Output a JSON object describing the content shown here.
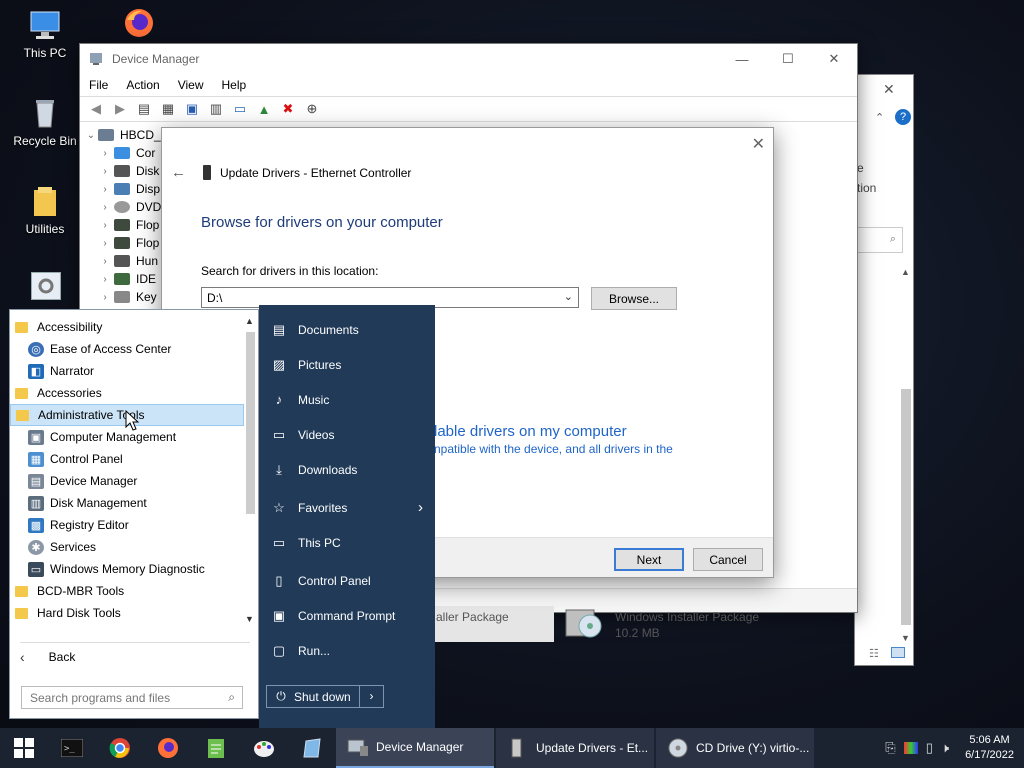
{
  "desktop": {
    "icons": [
      {
        "label": "This PC"
      },
      {
        "label": "Recycle Bin"
      },
      {
        "label": "Utilities"
      }
    ]
  },
  "device_manager": {
    "title": "Device Manager",
    "menu": [
      "File",
      "Action",
      "View",
      "Help"
    ],
    "tree": [
      "HBCD_",
      "Cor",
      "Disk",
      "Disp",
      "DVD",
      "Flop",
      "Flop",
      "Hun",
      "IDE",
      "Key"
    ]
  },
  "background_window": {
    "text_e": "e",
    "text_tion": "tion",
    "package1": "aller Package",
    "package2_name": "Windows Installer Package",
    "package2_size": "10.2 MB"
  },
  "update_dialog": {
    "title": "Update Drivers - Ethernet Controller",
    "heading": "Browse for drivers on your computer",
    "search_label": "Search for drivers in this location:",
    "path_value": "D:\\",
    "browse_label": "Browse...",
    "pick_link": "lable drivers on my computer",
    "pick_sub": "npatible with the device, and all drivers in the",
    "next_label": "Next",
    "cancel_label": "Cancel"
  },
  "start_menu": {
    "programs": [
      {
        "label": "Accessibility",
        "kind": "folder"
      },
      {
        "label": "Ease of Access Center",
        "kind": "item"
      },
      {
        "label": "Narrator",
        "kind": "item"
      },
      {
        "label": "Accessories",
        "kind": "folder"
      },
      {
        "label": "Administrative Tools",
        "kind": "folder",
        "selected": true
      },
      {
        "label": "Computer Management",
        "kind": "item"
      },
      {
        "label": "Control Panel",
        "kind": "item"
      },
      {
        "label": "Device Manager",
        "kind": "item"
      },
      {
        "label": "Disk Management",
        "kind": "item"
      },
      {
        "label": "Registry Editor",
        "kind": "item"
      },
      {
        "label": "Services",
        "kind": "item"
      },
      {
        "label": "Windows Memory Diagnostic",
        "kind": "item"
      },
      {
        "label": "BCD-MBR Tools",
        "kind": "folder"
      },
      {
        "label": "Hard Disk Tools",
        "kind": "folder"
      }
    ],
    "back_label": "Back",
    "search_placeholder": "Search programs and files",
    "places": [
      {
        "label": "Documents",
        "icon": "document-icon"
      },
      {
        "label": "Pictures",
        "icon": "picture-icon"
      },
      {
        "label": "Music",
        "icon": "music-icon"
      },
      {
        "label": "Videos",
        "icon": "video-icon"
      },
      {
        "label": "Downloads",
        "icon": "download-icon"
      },
      {
        "label": "Favorites",
        "icon": "star-icon"
      },
      {
        "label": "This PC",
        "icon": "computer-icon"
      },
      {
        "label": "Control Panel",
        "icon": "control-panel-icon"
      },
      {
        "label": "Command Prompt",
        "icon": "terminal-icon"
      },
      {
        "label": "Run...",
        "icon": "run-icon"
      }
    ],
    "shutdown_label": "Shut down"
  },
  "taskbar": {
    "tasks": [
      {
        "label": "Device Manager"
      },
      {
        "label": "Update Drivers - Et..."
      },
      {
        "label": "CD Drive (Y:) virtio-..."
      }
    ],
    "time": "5:06 AM",
    "date": "6/17/2022"
  }
}
